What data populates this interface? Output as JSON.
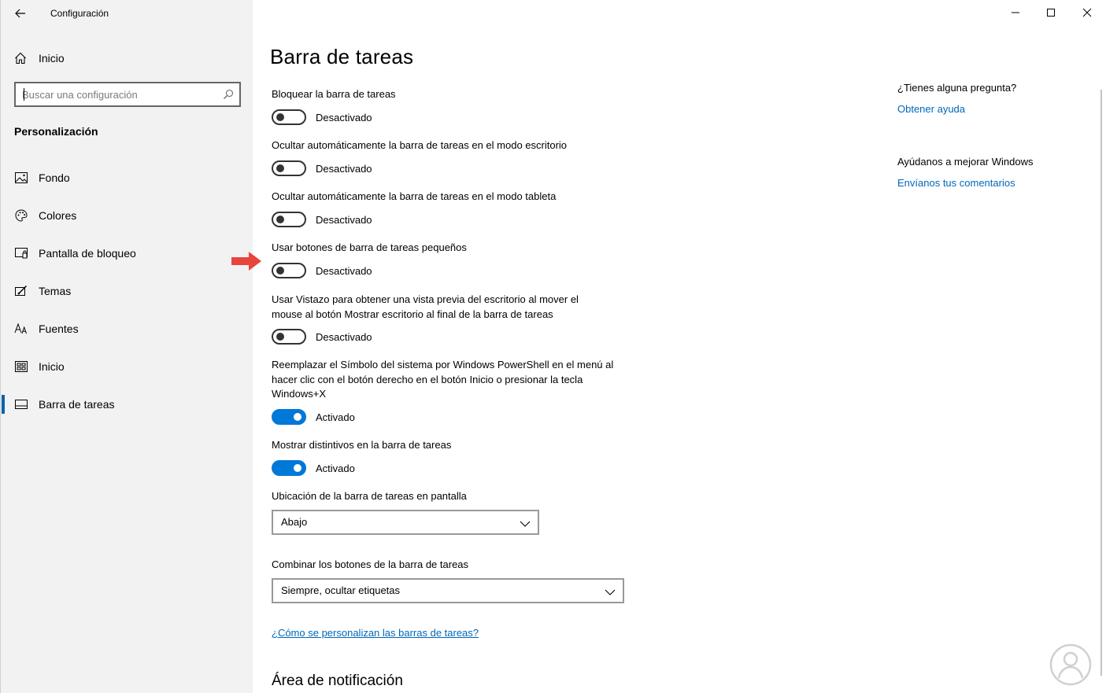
{
  "window": {
    "title": "Configuración",
    "controls": [
      "minimize",
      "maximize",
      "close"
    ]
  },
  "sidebar": {
    "home_label": "Inicio",
    "search_placeholder": "Buscar una configuración",
    "section_title": "Personalización",
    "items": [
      {
        "label": "Fondo",
        "icon": "picture-icon"
      },
      {
        "label": "Colores",
        "icon": "palette-icon"
      },
      {
        "label": "Pantalla de bloqueo",
        "icon": "lock-screen-icon"
      },
      {
        "label": "Temas",
        "icon": "themes-icon"
      },
      {
        "label": "Fuentes",
        "icon": "fonts-icon"
      },
      {
        "label": "Inicio",
        "icon": "start-icon"
      },
      {
        "label": "Barra de tareas",
        "icon": "taskbar-icon",
        "active": true
      }
    ]
  },
  "main": {
    "title": "Barra de tareas",
    "settings": [
      {
        "label": "Bloquear la barra de tareas",
        "state": "Desactivado",
        "on": false
      },
      {
        "label": "Ocultar automáticamente la barra de tareas en el modo escritorio",
        "state": "Desactivado",
        "on": false
      },
      {
        "label": "Ocultar automáticamente la barra de tareas en el modo tableta",
        "state": "Desactivado",
        "on": false
      },
      {
        "label": "Usar botones de barra de tareas pequeños",
        "state": "Desactivado",
        "on": false
      },
      {
        "label": "Usar Vistazo para obtener una vista previa del escritorio al mover el mouse al botón Mostrar escritorio al final de la barra de tareas",
        "state": "Desactivado",
        "on": false
      },
      {
        "label": "Reemplazar el Símbolo del sistema por Windows PowerShell en el menú al hacer clic con el botón derecho en el botón Inicio o presionar la tecla Windows+X",
        "state": "Activado",
        "on": true
      },
      {
        "label": "Mostrar distintivos en la barra de tareas",
        "state": "Activado",
        "on": true
      }
    ],
    "location": {
      "label": "Ubicación de la barra de tareas en pantalla",
      "value": "Abajo"
    },
    "combine": {
      "label": "Combinar los botones de la barra de tareas",
      "value": "Siempre, ocultar etiquetas"
    },
    "help_link": "¿Cómo se personalizan las barras de tareas?",
    "notification_title": "Área de notificación"
  },
  "aside": {
    "question": "¿Tienes alguna pregunta?",
    "help_link": "Obtener ayuda",
    "improve": "Ayúdanos a mejorar Windows",
    "feedback_link": "Envíanos tus comentarios"
  },
  "colors": {
    "accent": "#0078d7",
    "link": "#0067b8",
    "sidebar_bg": "#f2f2f2",
    "annotation_arrow": "#e8453c"
  }
}
